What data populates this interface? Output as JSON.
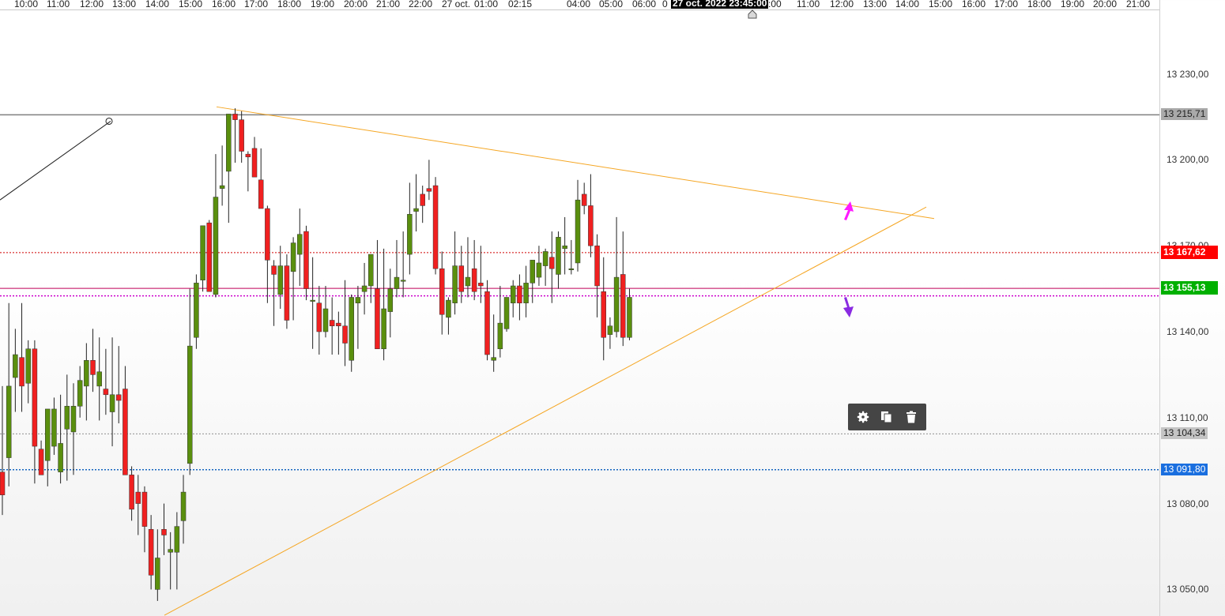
{
  "time_axis": {
    "labels": [
      "0",
      "10:00",
      "11:00",
      "12:00",
      "13:00",
      "14:00",
      "15:00",
      "16:00",
      "17:00",
      "18:00",
      "19:00",
      "20:00",
      "21:00",
      "22:00",
      "27 oct.",
      "01:00",
      "02:15",
      "04:00",
      "05:00",
      "06:00",
      "0",
      ":00",
      "11:00",
      "12:00",
      "13:00",
      "14:00",
      "15:00",
      "16:00",
      "17:00",
      "18:00",
      "19:00",
      "20:00",
      "21:00"
    ],
    "cursor_label": "27 oct. 2022 23:45:00"
  },
  "price_axis": {
    "ticks": [
      "13 230,00",
      "13 200,00",
      "13 170,00",
      "13 140,00",
      "13 110,00",
      "13 080,00",
      "13 050,00"
    ],
    "tags": [
      {
        "label": "13 215,71",
        "bg": "#a9a9a9",
        "fg": "#222222",
        "value": 13215.71
      },
      {
        "label": "13 167,62",
        "bg": "#ff0000",
        "fg": "#ffffff",
        "value": 13167.62
      },
      {
        "label": "13 155,13",
        "bg": "#00b000",
        "fg": "#ffffff",
        "value": 13155.13
      },
      {
        "label": "13 104,34",
        "bg": "#c4c4c4",
        "fg": "#222222",
        "value": 13104.34
      },
      {
        "label": "13 091,80",
        "bg": "#1a6fdf",
        "fg": "#ffffff",
        "value": 13091.8
      }
    ]
  },
  "colors": {
    "bull": "#5a8f0e",
    "bear": "#f02020",
    "trendline": "#f5a623",
    "resistance": "#808080",
    "red_level": "#d00000",
    "magenta_level": "#cc00cc",
    "blue_level": "#1565c0",
    "grey_level": "#909090",
    "arrow_up": "#ff1aff",
    "arrow_down": "#8a2be2"
  },
  "toolbox": {
    "icons": [
      "gear-icon",
      "copy-icon",
      "trash-icon"
    ]
  },
  "chart_data": {
    "type": "candlestick",
    "y_range": [
      13040,
      13250
    ],
    "levels": [
      {
        "name": "resistance",
        "value": 13215.71
      },
      {
        "name": "red",
        "value": 13167.62
      },
      {
        "name": "last",
        "value": 13155.13
      },
      {
        "name": "magenta",
        "value": 13152.5
      },
      {
        "name": "grey",
        "value": 13104.34
      },
      {
        "name": "blue",
        "value": 13091.8
      }
    ],
    "candles": [
      [
        13091,
        13121,
        13076,
        13083
      ],
      [
        13096,
        13150,
        13086,
        13121
      ],
      [
        13124,
        13141,
        13112,
        13132
      ],
      [
        13131,
        13150,
        13112,
        13121
      ],
      [
        13122,
        13137,
        13115,
        13134
      ],
      [
        13134,
        13137,
        13087,
        13100
      ],
      [
        13099,
        13102,
        13090,
        13090
      ],
      [
        13095,
        13112,
        13086,
        13113
      ],
      [
        13100,
        13117,
        13097,
        13113
      ],
      [
        13091,
        13118,
        13087,
        13101
      ],
      [
        13106,
        13125,
        13088,
        13114
      ],
      [
        13105,
        13122,
        13090,
        13114
      ],
      [
        13114,
        13128,
        13110,
        13123
      ],
      [
        13121,
        13136,
        13109,
        13130
      ],
      [
        13130,
        13141,
        13119,
        13125
      ],
      [
        13121,
        13138,
        13109,
        13126
      ],
      [
        13120,
        13134,
        13111,
        13118
      ],
      [
        13112,
        13138,
        13100,
        13118
      ],
      [
        13118,
        13135,
        13108,
        13116
      ],
      [
        13120,
        13128,
        13090,
        13090
      ],
      [
        13090,
        13093,
        13074,
        13078
      ],
      [
        13084,
        13090,
        13069,
        13080
      ],
      [
        13084,
        13086,
        13063,
        13072
      ],
      [
        13071,
        13076,
        13050,
        13055
      ],
      [
        13050,
        13071,
        13046,
        13061
      ],
      [
        13071,
        13080,
        13062,
        13069
      ],
      [
        13063,
        13070,
        13050,
        13064
      ],
      [
        13063,
        13077,
        13050,
        13072
      ],
      [
        13074,
        13090,
        13066,
        13084
      ],
      [
        13094,
        13155,
        13090,
        13135
      ],
      [
        13138,
        13160,
        13134,
        13157
      ],
      [
        13158,
        13173,
        13154,
        13177
      ],
      [
        13178,
        13179,
        13158,
        13154
      ],
      [
        13153,
        13202,
        13152,
        13187
      ],
      [
        13190,
        13205,
        13184,
        13191
      ],
      [
        13196,
        13216,
        13178,
        13216
      ],
      [
        13216,
        13218,
        13199,
        13214
      ],
      [
        13214,
        13217,
        13199,
        13203
      ],
      [
        13202,
        13203,
        13189,
        13201
      ],
      [
        13204,
        13208,
        13194,
        13194
      ],
      [
        13193,
        13204,
        13184,
        13183
      ],
      [
        13183,
        13184,
        13150,
        13165
      ],
      [
        13163,
        13165,
        13142,
        13160
      ],
      [
        13153,
        13170,
        13148,
        13163
      ],
      [
        13163,
        13167,
        13141,
        13144
      ],
      [
        13161,
        13173,
        13144,
        13171
      ],
      [
        13167,
        13183,
        13156,
        13174
      ],
      [
        13175,
        13177,
        13151,
        13155
      ],
      [
        13151,
        13166,
        13134,
        13151
      ],
      [
        13150,
        13156,
        13132,
        13140
      ],
      [
        13140,
        13156,
        13138,
        13148
      ],
      [
        13144,
        13152,
        13132,
        13142
      ],
      [
        13143,
        13147,
        13132,
        13142
      ],
      [
        13142,
        13158,
        13128,
        13136
      ],
      [
        13130,
        13153,
        13126,
        13152
      ],
      [
        13150,
        13156,
        13134,
        13152
      ],
      [
        13154,
        13164,
        13146,
        13156
      ],
      [
        13156,
        13163,
        13150,
        13167
      ],
      [
        13155,
        13172,
        13144,
        13134
      ],
      [
        13134,
        13169,
        13130,
        13148
      ],
      [
        13147,
        13162,
        13138,
        13155
      ],
      [
        13155,
        13172,
        13152,
        13159
      ],
      [
        13158,
        13175,
        13152,
        13158
      ],
      [
        13167,
        13192,
        13160,
        13181
      ],
      [
        13182,
        13195,
        13175,
        13183
      ],
      [
        13188,
        13191,
        13178,
        13184
      ],
      [
        13190,
        13200,
        13186,
        13189
      ],
      [
        13191,
        13194,
        13160,
        13162
      ],
      [
        13162,
        13168,
        13139,
        13146
      ],
      [
        13145,
        13152,
        13139,
        13151
      ],
      [
        13150,
        13175,
        13146,
        13163
      ],
      [
        13163,
        13170,
        13150,
        13154
      ],
      [
        13156,
        13173,
        13152,
        13159
      ],
      [
        13162,
        13172,
        13151,
        13154
      ],
      [
        13157,
        13170,
        13150,
        13156
      ],
      [
        13154,
        13158,
        13130,
        13132
      ],
      [
        13130,
        13146,
        13126,
        13131
      ],
      [
        13134,
        13156,
        13131,
        13143
      ],
      [
        13141,
        13151,
        13140,
        13152
      ],
      [
        13150,
        13158,
        13145,
        13156
      ],
      [
        13156,
        13160,
        13144,
        13150
      ],
      [
        13150,
        13163,
        13145,
        13157
      ],
      [
        13157,
        13164,
        13150,
        13165
      ],
      [
        13159,
        13170,
        13156,
        13164
      ],
      [
        13163,
        13169,
        13156,
        13168
      ],
      [
        13166,
        13175,
        13150,
        13162
      ],
      [
        13160,
        13175,
        13155,
        13173
      ],
      [
        13169,
        13180,
        13160,
        13170
      ],
      [
        13162,
        13172,
        13160,
        13162
      ],
      [
        13164,
        13193,
        13161,
        13186
      ],
      [
        13188,
        13192,
        13181,
        13184
      ],
      [
        13184,
        13195,
        13166,
        13170
      ],
      [
        13170,
        13174,
        13145,
        13156
      ],
      [
        13154,
        13166,
        13130,
        13138
      ],
      [
        13139,
        13145,
        13134,
        13142
      ],
      [
        13140,
        13180,
        13138,
        13159
      ],
      [
        13160,
        13175,
        13135,
        13138
      ],
      [
        13138,
        13155,
        13137,
        13152
      ]
    ],
    "trendlines": [
      {
        "name": "upper-descending",
        "from": [
          13218.5,
          0
        ],
        "to": [
          13179.5,
          1
        ],
        "x": [
          274,
          1182
        ]
      },
      {
        "name": "lower-ascending",
        "from": [
          13041,
          0
        ],
        "to": [
          13183.5,
          1
        ],
        "x": [
          208,
          1172
        ]
      },
      {
        "name": "black-line",
        "from": [
          13186,
          0
        ],
        "to": [
          13213.5,
          1
        ],
        "x": [
          0,
          140
        ]
      }
    ]
  }
}
